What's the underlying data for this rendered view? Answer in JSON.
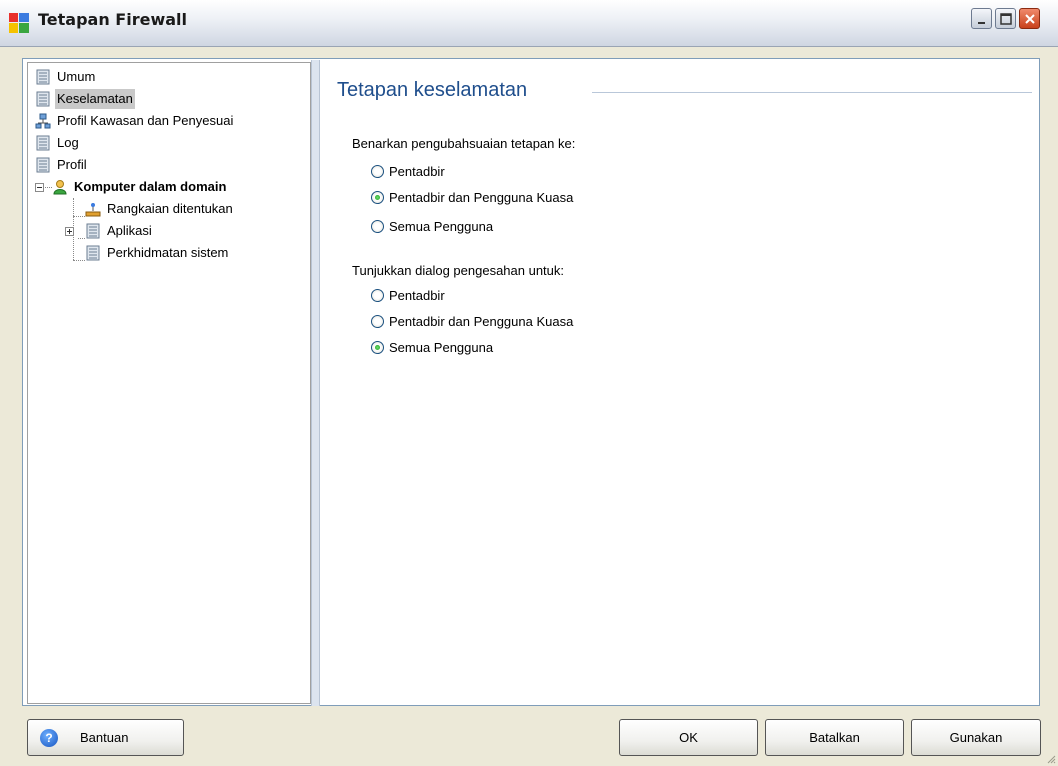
{
  "window": {
    "title": "Tetapan Firewall",
    "icon": "avg-logo-icon"
  },
  "tree": {
    "items": [
      {
        "label": "Umum",
        "icon": "document-icon"
      },
      {
        "label": "Keselamatan",
        "icon": "document-icon",
        "selected": true
      },
      {
        "label": "Profil Kawasan dan Penyesuai",
        "icon": "network-icon"
      },
      {
        "label": "Log",
        "icon": "document-icon"
      },
      {
        "label": "Profil",
        "icon": "document-icon"
      },
      {
        "label": "Komputer dalam domain",
        "icon": "user-icon",
        "expanded": true
      },
      {
        "label": "Rangkaian ditentukan",
        "icon": "network-icon"
      },
      {
        "label": "Aplikasi",
        "icon": "document-icon",
        "expanded": false
      },
      {
        "label": "Perkhidmatan sistem",
        "icon": "document-icon"
      }
    ]
  },
  "content": {
    "title": "Tetapan keselamatan",
    "group1": {
      "label": "Benarkan pengubahsuaian tetapan ke:",
      "options": [
        "Pentadbir",
        "Pentadbir dan Pengguna Kuasa",
        "Semua Pengguna"
      ],
      "selected": "Pentadbir dan Pengguna Kuasa"
    },
    "group2": {
      "label": "Tunjukkan dialog pengesahan untuk:",
      "options": [
        "Pentadbir",
        "Pentadbir dan Pengguna Kuasa",
        "Semua Pengguna"
      ],
      "selected": "Semua Pengguna"
    }
  },
  "buttons": {
    "help": "Bantuan",
    "ok": "OK",
    "cancel": "Batalkan",
    "apply": "Gunakan"
  },
  "colors": {
    "accent_title": "#1f4e8c",
    "selection": "#c9c9c9",
    "radio_dot": "#1d9a1d"
  }
}
